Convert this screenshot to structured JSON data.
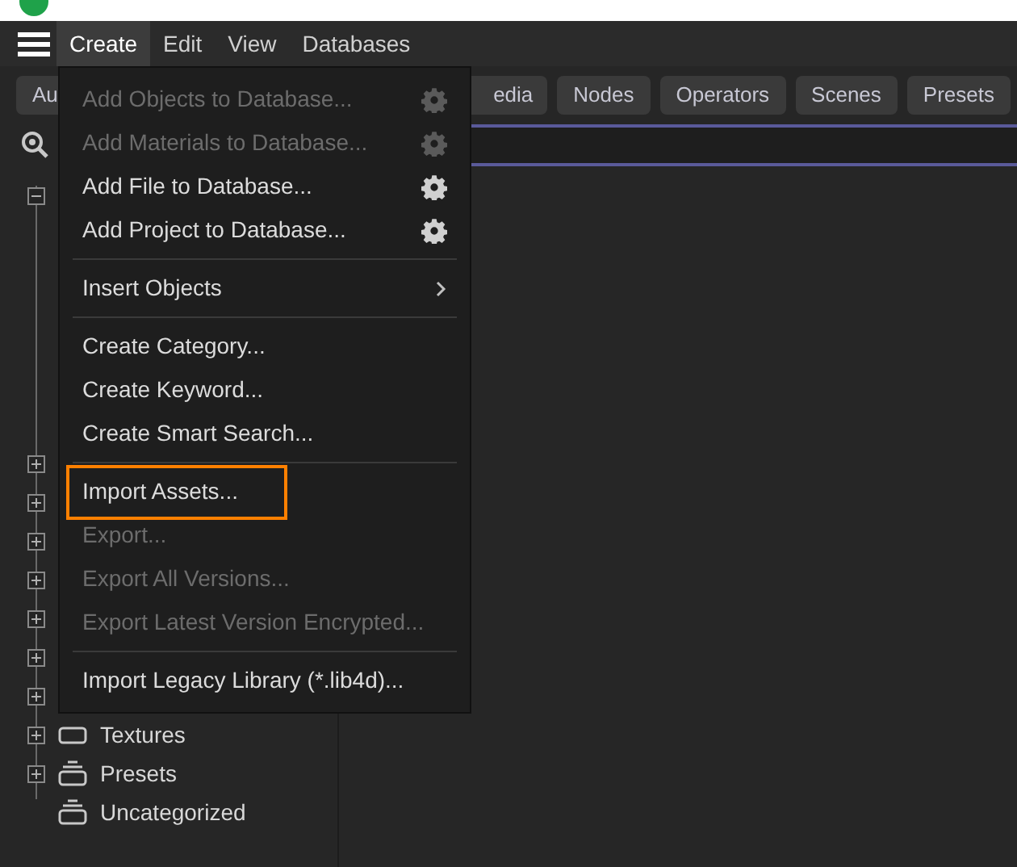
{
  "menu_bar": [
    {
      "label": "Create",
      "selected": true
    },
    {
      "label": "Edit",
      "selected": false
    },
    {
      "label": "View",
      "selected": false
    },
    {
      "label": "Databases",
      "selected": false
    }
  ],
  "filter_tabs": [
    "Au",
    "edia",
    "Nodes",
    "Operators",
    "Scenes",
    "Presets"
  ],
  "tree": {
    "expanded": true,
    "children": [
      {
        "expanded": false
      },
      {
        "expanded": false
      },
      {
        "expanded": false
      },
      {
        "expanded": false
      },
      {
        "expanded": false
      },
      {
        "expanded": false
      },
      {
        "expanded": false
      },
      {
        "label": "Textures",
        "kind": "folder",
        "expanded": false
      },
      {
        "label": "Presets",
        "kind": "stack",
        "expanded": false
      },
      {
        "label": "Uncategorized",
        "kind": "stack"
      }
    ]
  },
  "dropdown": [
    {
      "kind": "item",
      "label": "Add Objects to Database...",
      "disabled": true,
      "settings": true
    },
    {
      "kind": "item",
      "label": "Add Materials to Database...",
      "disabled": true,
      "settings": true
    },
    {
      "kind": "item",
      "label": "Add File to Database...",
      "disabled": false,
      "settings": true
    },
    {
      "kind": "item",
      "label": "Add Project to Database...",
      "disabled": false,
      "settings": true
    },
    {
      "kind": "separator"
    },
    {
      "kind": "submenu",
      "label": "Insert Objects",
      "disabled": false
    },
    {
      "kind": "separator"
    },
    {
      "kind": "item",
      "label": "Create Category...",
      "disabled": false
    },
    {
      "kind": "item",
      "label": "Create Keyword...",
      "disabled": false
    },
    {
      "kind": "item",
      "label": "Create Smart Search...",
      "disabled": false
    },
    {
      "kind": "separator"
    },
    {
      "kind": "item",
      "label": "Import Assets...",
      "disabled": false,
      "highlighted": true
    },
    {
      "kind": "item",
      "label": "Export...",
      "disabled": true
    },
    {
      "kind": "item",
      "label": "Export All Versions...",
      "disabled": true
    },
    {
      "kind": "item",
      "label": "Export Latest Version Encrypted...",
      "disabled": true
    },
    {
      "kind": "separator"
    },
    {
      "kind": "item",
      "label": "Import Legacy Library (*.lib4d)...",
      "disabled": false
    }
  ]
}
